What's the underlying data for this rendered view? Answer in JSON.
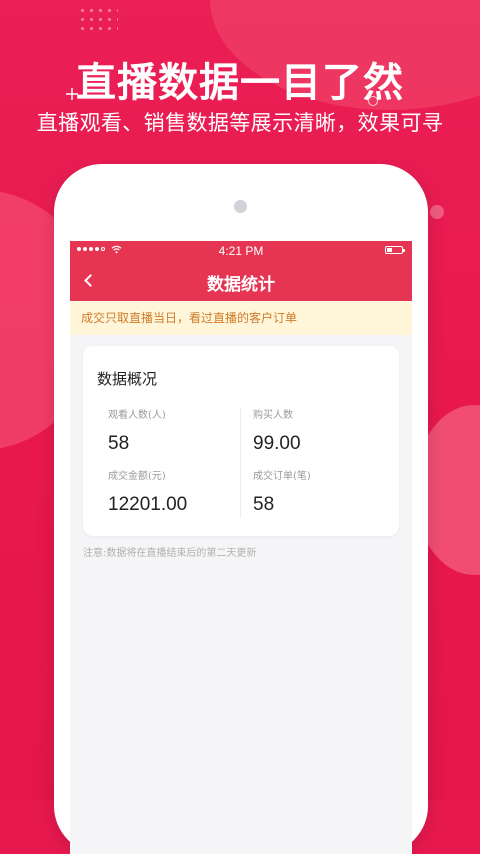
{
  "promo": {
    "title": "直播数据一目了然",
    "subtitle": "直播观看、销售数据等展示清晰，效果可寻"
  },
  "status_bar": {
    "time": "4:21 PM"
  },
  "nav": {
    "title": "数据统计"
  },
  "notice": {
    "text": "成交只取直播当日，看过直播的客户订单"
  },
  "stats": {
    "title": "数据概况",
    "items": [
      {
        "label": "观看人数(人)",
        "value": "58"
      },
      {
        "label": "购买人数",
        "value": "99.00"
      },
      {
        "label": "成交金额(元)",
        "value": "12201.00"
      },
      {
        "label": "成交订单(笔)",
        "value": "58"
      }
    ]
  },
  "footnote": {
    "text": "注意:数据将在直播结束后的第二天更新"
  },
  "colors": {
    "background": "#E8194F",
    "accent": "#E53553",
    "notice_bg": "#FFF5D9",
    "notice_text": "#D07C2A"
  },
  "icons": {
    "back": "chevron-left-icon",
    "wifi": "wifi-icon",
    "battery": "battery-icon",
    "camera": "camera-icon"
  }
}
